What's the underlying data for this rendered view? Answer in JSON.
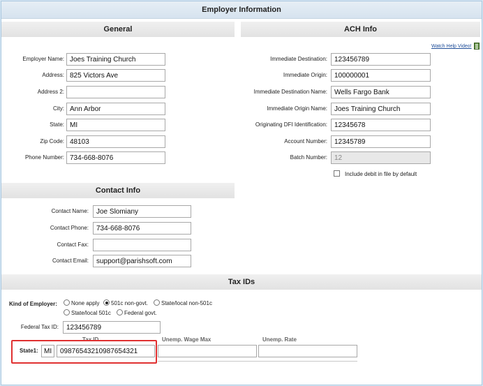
{
  "title": "Employer Information",
  "general": {
    "heading": "General",
    "employer_name_label": "Employer Name:",
    "employer_name": "Joes Training Church",
    "address_label": "Address:",
    "address": "825 Victors Ave",
    "address2_label": "Address 2:",
    "address2": "",
    "city_label": "City:",
    "city": "Ann Arbor",
    "state_label": "State:",
    "state": "MI",
    "zip_label": "Zip Code:",
    "zip": "48103",
    "phone_label": "Phone Number:",
    "phone": "734-668-8076"
  },
  "ach": {
    "heading": "ACH Info",
    "help_link": "Watch Help Video!",
    "dest_label": "Immediate Destination:",
    "dest": "123456789",
    "origin_label": "Immediate Origin:",
    "origin": "100000001",
    "dest_name_label": "Immediate Destination Name:",
    "dest_name": "Wells Fargo Bank",
    "origin_name_label": "Immediate Origin Name:",
    "origin_name": "Joes Training Church",
    "dfi_label": "Originating DFI Identification:",
    "dfi": "12345678",
    "account_label": "Account Number:",
    "account": "12345789",
    "batch_label": "Batch Number:",
    "batch": "12",
    "include_debit_label": "Include debit in file by default",
    "include_debit_checked": false
  },
  "contact": {
    "heading": "Contact Info",
    "name_label": "Contact Name:",
    "name": "Joe Slomiany",
    "phone_label": "Contact Phone:",
    "phone": "734-668-8076",
    "fax_label": "Contact Fax:",
    "fax": "",
    "email_label": "Contact Email:",
    "email": "support@parishsoft.com"
  },
  "tax": {
    "heading": "Tax IDs",
    "kind_label": "Kind of Employer:",
    "options": [
      "None apply",
      "501c non-govt.",
      "State/local non-501c",
      "State/local 501c",
      "Federal govt."
    ],
    "selected": "501c non-govt.",
    "federal_label": "Federal Tax ID:",
    "federal": "123456789",
    "col_tax_id": "Tax ID",
    "col_wage_max": "Unemp. Wage Max",
    "col_rate": "Unemp. Rate",
    "state1_label": "State1:",
    "state1_code": "MI",
    "state1_tax_id": "09876543210987654321",
    "state1_wage_max": "",
    "state1_rate": ""
  },
  "colors": {
    "highlight": "#e03131",
    "link": "#1f4e99"
  }
}
